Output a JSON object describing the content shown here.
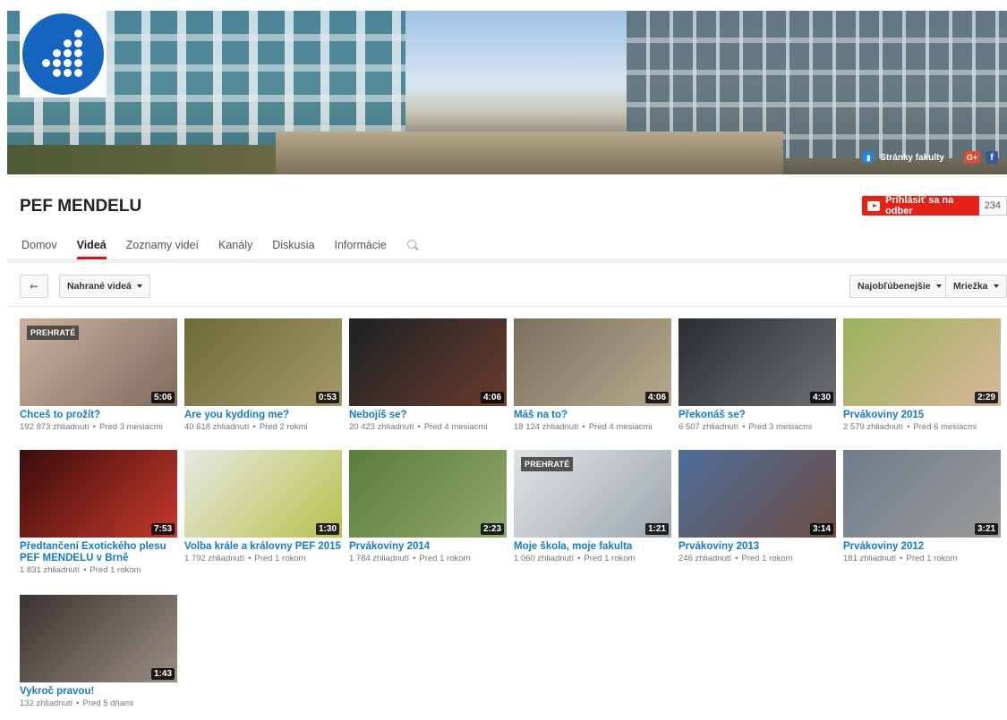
{
  "banner": {
    "links_label": "Stránky fakulty",
    "gplus_label": "G+",
    "facebook_label": "f"
  },
  "channel": {
    "name": "PEF MENDELU",
    "subscribe_label": "Prihlásiť sa na odber",
    "subscriber_count": "234"
  },
  "tabs": [
    {
      "label": "Domov",
      "active": false
    },
    {
      "label": "Videá",
      "active": true
    },
    {
      "label": "Zoznamy videí",
      "active": false
    },
    {
      "label": "Kanály",
      "active": false
    },
    {
      "label": "Diskusia",
      "active": false
    },
    {
      "label": "Informácie",
      "active": false
    }
  ],
  "toolbar": {
    "back_label": "⇜",
    "filter_label": "Nahrané videá",
    "sort_label": "Najobľúbenejšie",
    "view_label": "Mriežka"
  },
  "videos": [
    {
      "title": "Chceš to prožít?",
      "views": "192 873 zhliadnutí",
      "age": "Pred 3 mesiacmi",
      "duration": "5:06",
      "watched": "PREHRATÉ",
      "colors": [
        "#c9b2a0",
        "#7f6a5c"
      ]
    },
    {
      "title": "Are you kydding me?",
      "views": "40 618 zhliadnutí",
      "age": "Pred 2 rokmi",
      "duration": "0:53",
      "watched": "",
      "colors": [
        "#6e6a3a",
        "#a59868"
      ]
    },
    {
      "title": "Nebojíš se?",
      "views": "20 423 zhliadnutí",
      "age": "Pred 4 mesiacmi",
      "duration": "4:06",
      "watched": "",
      "colors": [
        "#1b2226",
        "#6a3b2c"
      ]
    },
    {
      "title": "Máš na to?",
      "views": "18 124 zhliadnutí",
      "age": "Pred 4 mesiacmi",
      "duration": "4:06",
      "watched": "",
      "colors": [
        "#7a705e",
        "#b7a98d"
      ]
    },
    {
      "title": "Překonáš se?",
      "views": "6 507 zhliadnutí",
      "age": "Pred 3 mesiacmi",
      "duration": "4:30",
      "watched": "",
      "colors": [
        "#2a2d30",
        "#6c7074"
      ]
    },
    {
      "title": "Prvákoviny 2015",
      "views": "2 579 zhliadnutí",
      "age": "Pred 6 mesiacmi",
      "duration": "2:29",
      "watched": "",
      "colors": [
        "#9ab25c",
        "#d9b69a"
      ]
    },
    {
      "title": "Předtančení Exotického plesu PEF MENDELU v Brně",
      "views": "1 831 zhliadnutí",
      "age": "Pred 1 rokom",
      "duration": "7:53",
      "watched": "",
      "colors": [
        "#3a0c0c",
        "#c8382a"
      ]
    },
    {
      "title": "Volba krále a královny PEF 2015",
      "views": "1 792 zhliadnutí",
      "age": "Pred 1 rokom",
      "duration": "1:30",
      "watched": "",
      "colors": [
        "#e8e8e4",
        "#b6c24a"
      ]
    },
    {
      "title": "Prvákoviny 2014",
      "views": "1 784 zhliadnutí",
      "age": "Pred 1 rokom",
      "duration": "2:23",
      "watched": "",
      "colors": [
        "#5a7d3a",
        "#8fa86a"
      ]
    },
    {
      "title": "Moje škola, moje fakulta",
      "views": "1 060 zhliadnutí",
      "age": "Pred 1 rokom",
      "duration": "1:21",
      "watched": "PREHRATÉ",
      "colors": [
        "#dfe3e6",
        "#9ea7ad"
      ]
    },
    {
      "title": "Prvákoviny 2013",
      "views": "246 zhliadnutí",
      "age": "Pred 1 rokom",
      "duration": "3:14",
      "watched": "",
      "colors": [
        "#4c6e99",
        "#6f4d44"
      ]
    },
    {
      "title": "Prvákoviny 2012",
      "views": "181 zhliadnutí",
      "age": "Pred 1 rokom",
      "duration": "3:21",
      "watched": "",
      "colors": [
        "#6f7c8c",
        "#9a9a98"
      ]
    },
    {
      "title": "Vykroč pravou!",
      "views": "132 zhliadnutí",
      "age": "Pred 5 dňami",
      "duration": "1:43",
      "watched": "",
      "colors": [
        "#3a3230",
        "#9c8f84"
      ]
    }
  ],
  "meta_separator": "•"
}
